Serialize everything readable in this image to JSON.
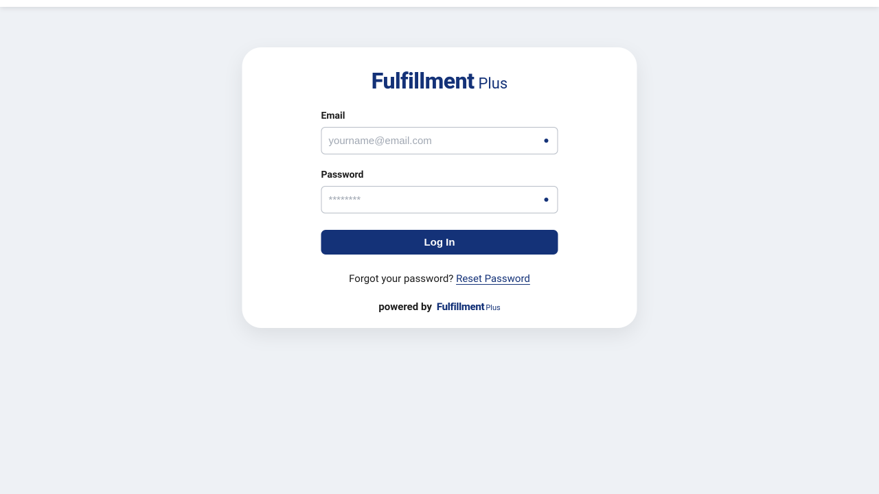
{
  "logo": {
    "main": "Fulfillment",
    "sub": "Plus"
  },
  "form": {
    "email_label": "Email",
    "email_placeholder": "yourname@email.com",
    "password_label": "Password",
    "password_placeholder": "********",
    "submit_label": "Log In"
  },
  "forgot": {
    "question": "Forgot your password? ",
    "link_text": "Reset Password"
  },
  "footer": {
    "powered_text": "powered by",
    "logo_main": "Fulfillment",
    "logo_sub": "Plus"
  }
}
